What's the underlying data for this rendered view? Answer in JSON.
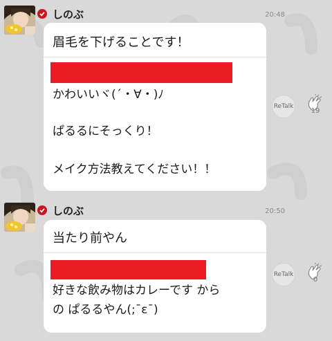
{
  "posts": [
    {
      "author": "しのぶ",
      "time": "20:48",
      "message": "眉毛を下げることです！",
      "reply_lines": [
        "かわいいヾ(´・∀・)ﾉ",
        "",
        "ぱるるにそっくり！",
        "",
        "メイク方法教えてください！！"
      ],
      "retalk_label": "ReTalk",
      "clap_count": "19"
    },
    {
      "author": "しのぶ",
      "time": "20:50",
      "message": "当たり前やん",
      "reply_lines": [
        "好きな飲み物はカレーです から",
        "の ぱるるやん(;¯ε¯)"
      ],
      "retalk_label": "ReTalk",
      "clap_count": "0"
    }
  ],
  "colors": {
    "background": "#d9d9d9",
    "verified_badge": "#c8161e",
    "redaction": "#ec1c24"
  },
  "icons": [
    "verified-check-icon",
    "clap-icon"
  ]
}
